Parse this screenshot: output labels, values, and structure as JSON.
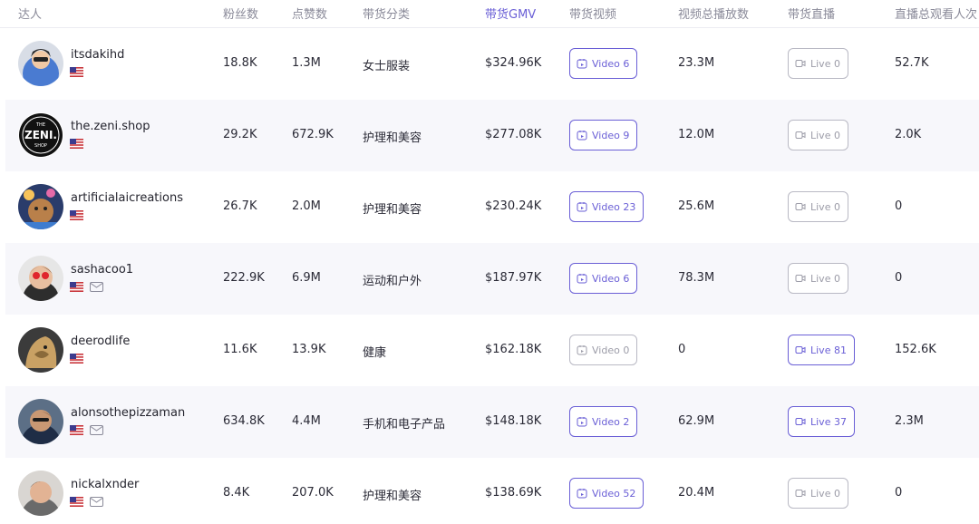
{
  "columns": {
    "creator": "达人",
    "followers": "粉丝数",
    "likes": "点赞数",
    "category": "带货分类",
    "gmv": "带货GMV",
    "videos": "带货视频",
    "total_views": "视频总播放数",
    "live": "带货直播",
    "live_viewers": "直播总观看人次"
  },
  "sort_column": "gmv",
  "accent_color": "#6a5fd6",
  "rows": [
    {
      "username": "itsdakihd",
      "has_email": false,
      "followers": "18.8K",
      "likes": "1.3M",
      "category": "女士服装",
      "gmv": "$324.96K",
      "video_label": "Video 6",
      "video_active": true,
      "views": "23.3M",
      "live_label": "Live 0",
      "live_active": false,
      "live_viewers": "52.7K"
    },
    {
      "username": "the.zeni.shop",
      "has_email": false,
      "followers": "29.2K",
      "likes": "672.9K",
      "category": "护理和美容",
      "gmv": "$277.08K",
      "video_label": "Video 9",
      "video_active": true,
      "views": "12.0M",
      "live_label": "Live 0",
      "live_active": false,
      "live_viewers": "2.0K"
    },
    {
      "username": "artificialaicreations",
      "has_email": false,
      "followers": "26.7K",
      "likes": "2.0M",
      "category": "护理和美容",
      "gmv": "$230.24K",
      "video_label": "Video 23",
      "video_active": true,
      "views": "25.6M",
      "live_label": "Live 0",
      "live_active": false,
      "live_viewers": "0"
    },
    {
      "username": "sashacoo1",
      "has_email": true,
      "followers": "222.9K",
      "likes": "6.9M",
      "category": "运动和户外",
      "gmv": "$187.97K",
      "video_label": "Video 6",
      "video_active": true,
      "views": "78.3M",
      "live_label": "Live 0",
      "live_active": false,
      "live_viewers": "0"
    },
    {
      "username": "deerodlife",
      "has_email": false,
      "followers": "11.6K",
      "likes": "13.9K",
      "category": "健康",
      "gmv": "$162.18K",
      "video_label": "Video 0",
      "video_active": false,
      "views": "0",
      "live_label": "Live 81",
      "live_active": true,
      "live_viewers": "152.6K"
    },
    {
      "username": "alonsothepizzaman",
      "has_email": true,
      "followers": "634.8K",
      "likes": "4.4M",
      "category": "手机和电子产品",
      "gmv": "$148.18K",
      "video_label": "Video 2",
      "video_active": true,
      "views": "62.9M",
      "live_label": "Live 37",
      "live_active": true,
      "live_viewers": "2.3M"
    },
    {
      "username": "nickalxnder",
      "has_email": true,
      "followers": "8.4K",
      "likes": "207.0K",
      "category": "护理和美容",
      "gmv": "$138.69K",
      "video_label": "Video 52",
      "video_active": true,
      "views": "20.4M",
      "live_label": "Live 0",
      "live_active": false,
      "live_viewers": "0"
    }
  ],
  "avatar_logo": {
    "line1": "THE",
    "line2": "ZENI.",
    "line3": "SHOP"
  }
}
